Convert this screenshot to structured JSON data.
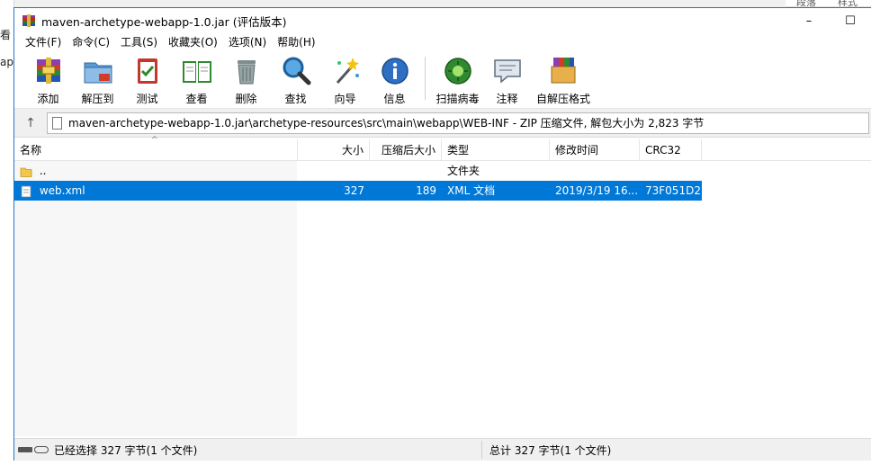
{
  "window": {
    "title": "maven-archetype-webapp-1.0.jar (评估版本)",
    "minimize_label": "–",
    "maximize_label": "☐"
  },
  "menu": [
    "文件(F)",
    "命令(C)",
    "工具(S)",
    "收藏夹(O)",
    "选项(N)",
    "帮助(H)"
  ],
  "toolbar": {
    "add": "添加",
    "extract": "解压到",
    "test": "测试",
    "view": "查看",
    "delete": "删除",
    "find": "查找",
    "wizard": "向导",
    "info": "信息",
    "virus": "扫描病毒",
    "comment": "注释",
    "sfx": "自解压格式"
  },
  "address": {
    "path": "maven-archetype-webapp-1.0.jar\\archetype-resources\\src\\main\\webapp\\WEB-INF - ZIP 压缩文件, 解包大小为 2,823 字节"
  },
  "columns": {
    "name": "名称",
    "size": "大小",
    "packed": "压缩后大小",
    "type": "类型",
    "modified": "修改时间",
    "crc": "CRC32"
  },
  "rows": [
    {
      "name": "..",
      "size": "",
      "packed": "",
      "type": "文件夹",
      "modified": "",
      "crc": ""
    },
    {
      "name": "web.xml",
      "size": "327",
      "packed": "189",
      "type": "XML 文档",
      "modified": "2019/3/19 16...",
      "crc": "73F051D2"
    }
  ],
  "status": {
    "left": "已经选择 327 字节(1 个文件)",
    "right": "总计 327 字节(1 个文件)"
  },
  "background": {
    "left_frag_1": "看",
    "left_frag_2": "ap",
    "top_right_1": "段落",
    "top_right_2": "样式"
  }
}
